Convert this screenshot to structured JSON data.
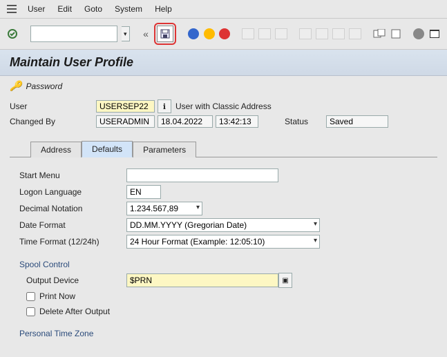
{
  "menu": {
    "items": [
      "User",
      "Edit",
      "Goto",
      "System",
      "Help"
    ]
  },
  "toolbar": {
    "ok_code": ""
  },
  "title": "Maintain User Profile",
  "password_button": "Password",
  "header": {
    "user_label": "User",
    "user_value": "USERSEP22",
    "user_desc": "User with Classic Address",
    "changed_by_label": "Changed By",
    "changed_by_value": "USERADMIN",
    "changed_date": "18.04.2022",
    "changed_time": "13:42:13",
    "status_label": "Status",
    "status_value": "Saved"
  },
  "tabs": [
    "Address",
    "Defaults",
    "Parameters"
  ],
  "active_tab": "Defaults",
  "defaults": {
    "start_menu_label": "Start Menu",
    "start_menu_value": "",
    "logon_lang_label": "Logon Language",
    "logon_lang_value": "EN",
    "dec_notation_label": "Decimal Notation",
    "dec_notation_value": "1.234.567,89",
    "date_format_label": "Date Format",
    "date_format_value": "DD.MM.YYYY (Gregorian Date)",
    "time_format_label": "Time Format (12/24h)",
    "time_format_value": "24 Hour Format (Example: 12:05:10)",
    "spool_group": "Spool Control",
    "output_device_label": "Output Device",
    "output_device_value": "$PRN",
    "print_now_label": "Print Now",
    "delete_after_label": "Delete After Output",
    "personal_tz_group": "Personal Time Zone"
  }
}
